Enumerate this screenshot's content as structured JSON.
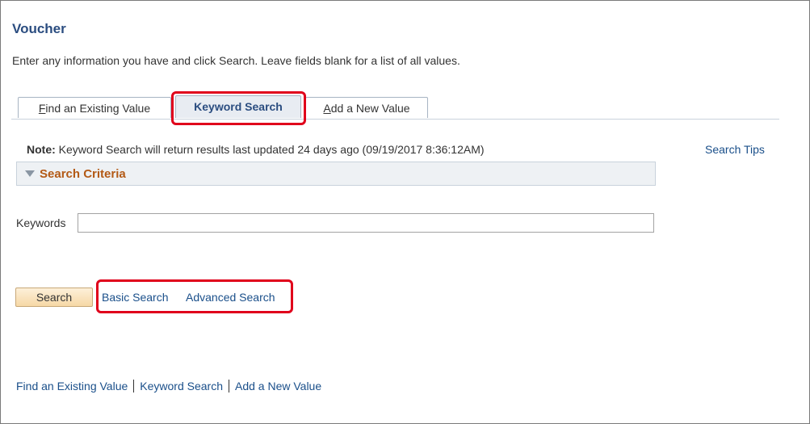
{
  "page": {
    "title": "Voucher",
    "instructions": "Enter any information you have and click Search. Leave fields blank for a list of all values."
  },
  "tabs": [
    {
      "accesskey": "F",
      "rest": "ind an Existing Value",
      "active": false
    },
    {
      "label": "Keyword Search",
      "active": true
    },
    {
      "accesskey": "A",
      "rest": "dd a New Value",
      "active": false
    }
  ],
  "note": {
    "prefix": "Note:",
    "text": " Keyword Search will return results last updated 24 days ago (09/19/2017 8:36:12AM)"
  },
  "search_tips_label": "Search Tips",
  "criteria": {
    "label": "Search Criteria",
    "keywords_label": "Keywords",
    "keywords_value": ""
  },
  "actions": {
    "search_label": "Search",
    "basic_search_label": "Basic Search",
    "advanced_search_label": "Advanced Search"
  },
  "footer_links": [
    "Find an Existing Value",
    "Keyword Search",
    "Add a New Value"
  ],
  "colors": {
    "title": "#2b4d80",
    "link": "#1a4f8a",
    "criteria_label": "#b35a16",
    "highlight": "#e0001b"
  }
}
